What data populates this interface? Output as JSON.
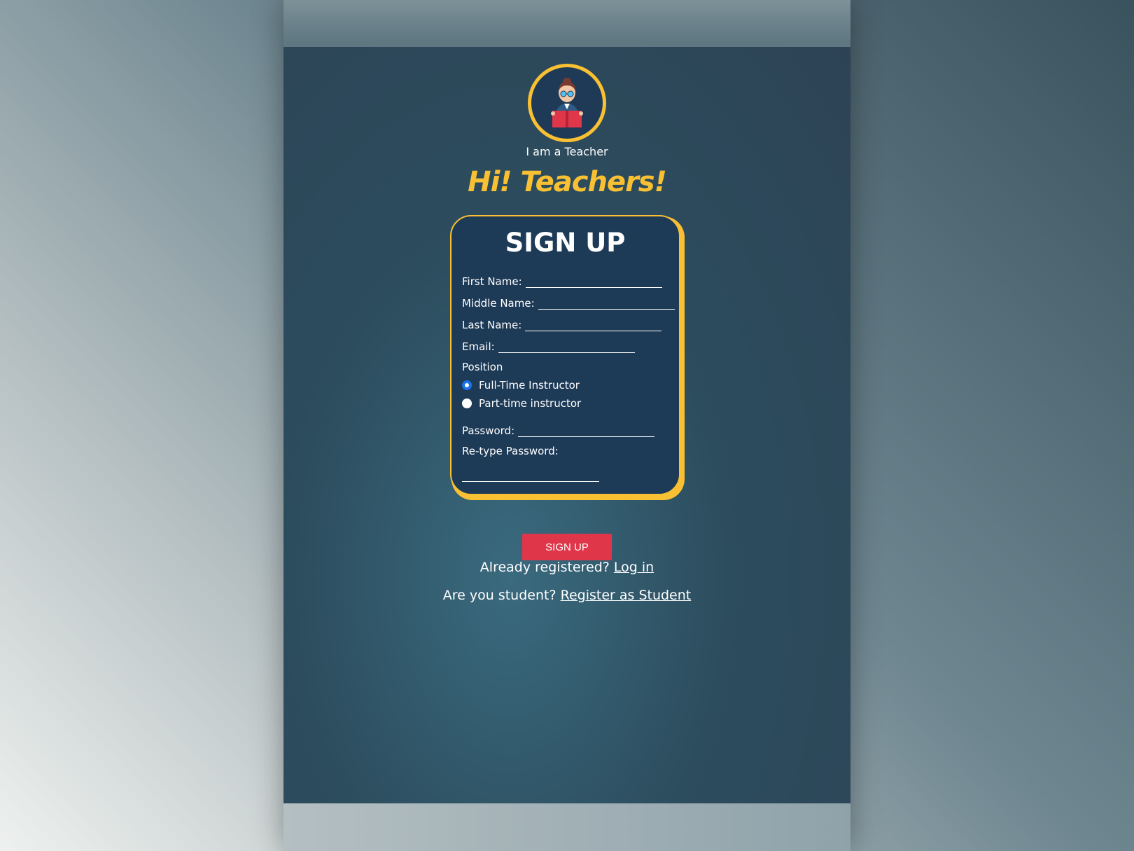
{
  "role": {
    "label": "I am a Teacher",
    "icon": "teacher-reading-book-icon"
  },
  "greeting": "Hi! Teachers!",
  "form": {
    "title": "SIGN UP",
    "fields": {
      "first_name": {
        "label": "First Name:",
        "value": ""
      },
      "middle_name": {
        "label": "Middle Name:",
        "value": ""
      },
      "last_name": {
        "label": "Last Name:",
        "value": ""
      },
      "email": {
        "label": "Email:",
        "value": ""
      },
      "password": {
        "label": "Password:",
        "value": ""
      },
      "retype_password": {
        "label": "Re-type Password:",
        "value": ""
      }
    },
    "position": {
      "label": "Position",
      "options": [
        {
          "label": "Full-Time Instructor",
          "checked": true
        },
        {
          "label": "Part-time instructor",
          "checked": false
        }
      ]
    }
  },
  "signup_button": "SIGN UP",
  "login_prompt": {
    "text": "Already registered?",
    "link": "Log in"
  },
  "student_prompt": {
    "text": "Are you student?",
    "link": "Register as Student"
  },
  "colors": {
    "accent": "#f8c032",
    "card": "#1d3a57",
    "button": "#e0364a",
    "radio_checked": "#1a73e8"
  }
}
